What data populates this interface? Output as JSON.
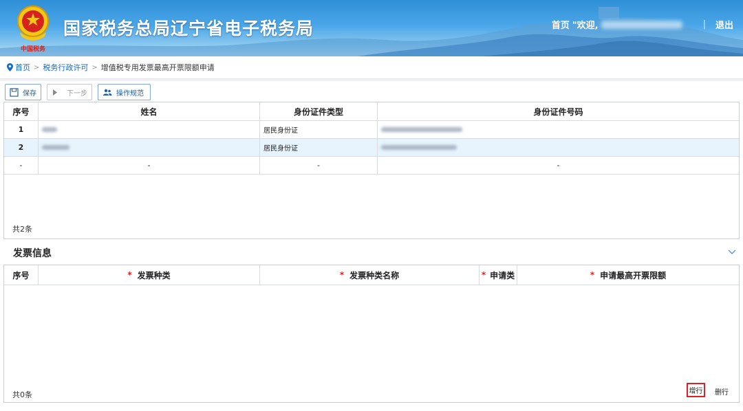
{
  "header": {
    "title": "国家税务总局辽宁省电子税务局",
    "home_label": "首页",
    "welcome_label": "\"欢迎,",
    "logout_label": "退出",
    "sep": "|",
    "emblem_text": "中国税务"
  },
  "breadcrumb": {
    "home": "首页",
    "level1": "税务行政许可",
    "current": "增值税专用发票最高开票限额申请",
    "arrow": ">"
  },
  "toolbar": {
    "save": "保存",
    "next": "下一步",
    "guide": "操作规范"
  },
  "people_table": {
    "headers": [
      "序号",
      "姓名",
      "身份证件类型",
      "身份证件号码"
    ],
    "rows": [
      {
        "index": "1",
        "id_type": "居民身份证"
      },
      {
        "index": "2",
        "id_type": "居民身份证"
      },
      {
        "index": "-",
        "name": "-",
        "id_type": "-",
        "id_number": "-"
      }
    ],
    "count_label": "共2条"
  },
  "invoice_section": {
    "title": "发票信息",
    "headers": [
      "序号",
      "发票种类",
      "发票种类名称",
      "申请类",
      "申请最高开票限额"
    ],
    "required_mark": "*",
    "count_label": "共0条",
    "add_row": "增行",
    "delete_row": "删行"
  },
  "colors": {
    "header_blue": "#2f8fd6",
    "link_blue": "#1769c3",
    "required_red": "#e02020",
    "selected_row": "#e8f4fd"
  }
}
